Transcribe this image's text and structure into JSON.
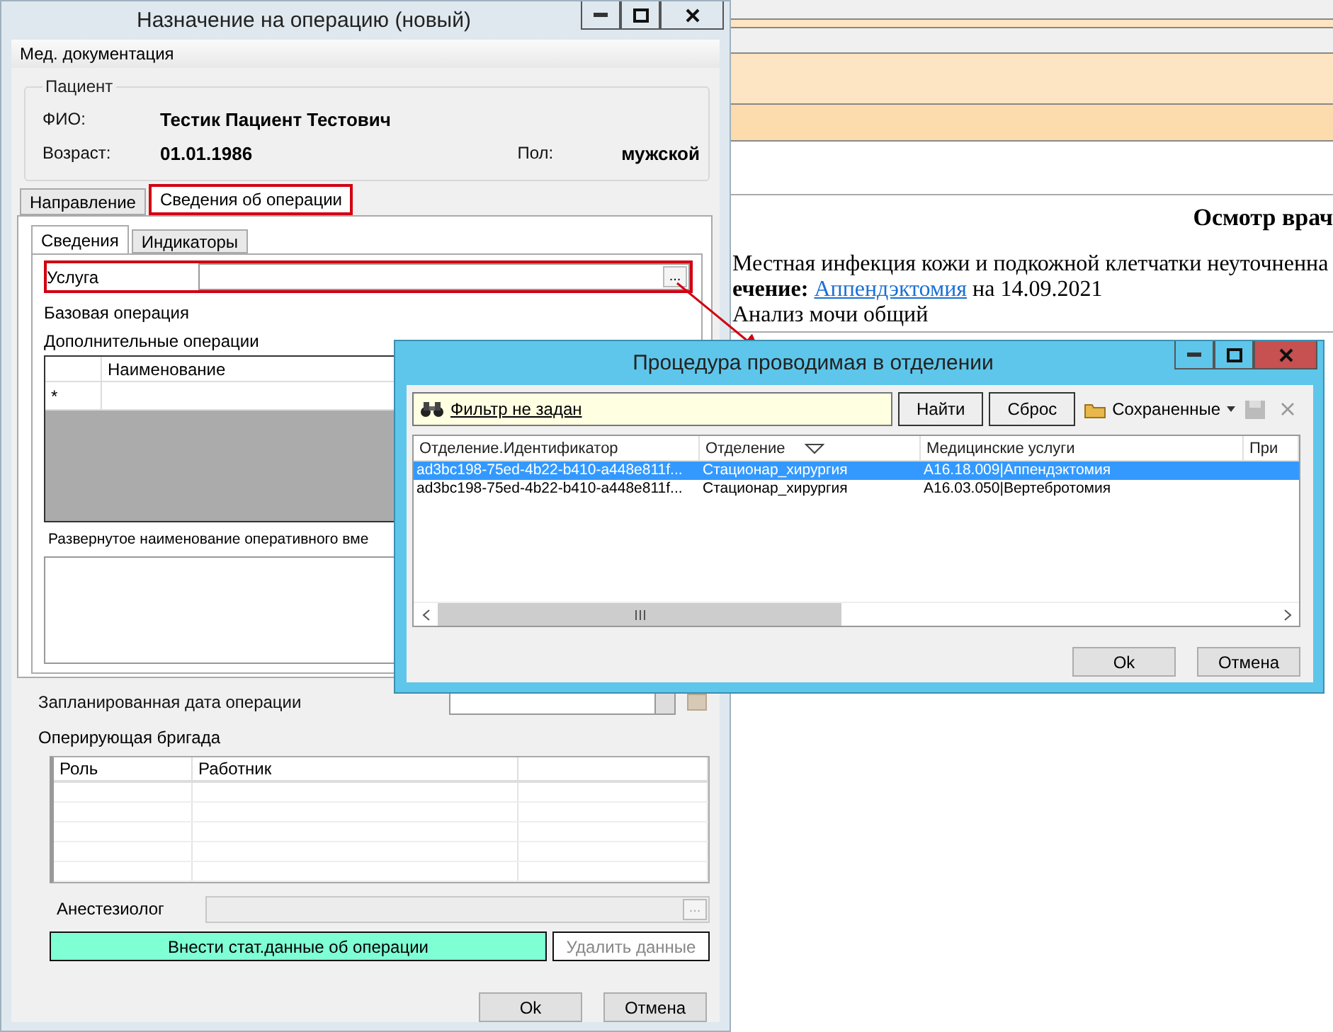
{
  "background_document": {
    "title": "Осмотр врач",
    "lines": [
      {
        "kind": "plain",
        "text": "Местная инфекция кожи и подкожной клетчатки неуточненна"
      },
      {
        "kind": "link",
        "label": "ечение:",
        "link": "Аппендэктомия",
        "text": "на 14.09.2021"
      },
      {
        "kind": "plain",
        "text": "Анализ мочи общий"
      }
    ]
  },
  "main_window": {
    "title": "Назначение на операцию (новый)",
    "menu": [
      "Мед. документация"
    ],
    "patient": {
      "group_title": "Пациент",
      "name_label": "ФИО:",
      "name": "Тестик Пациент Тестович",
      "age_label": "Возраст:",
      "age": "01.01.1986",
      "sex_label": "Пол:",
      "sex": "мужской"
    },
    "tabs": [
      {
        "label": "Направление",
        "selected": false,
        "highlighted": false
      },
      {
        "label": "Сведения об операции",
        "selected": true,
        "highlighted": true
      }
    ],
    "subtabs": [
      {
        "label": "Сведения",
        "selected": true
      },
      {
        "label": "Индикаторы",
        "selected": false
      }
    ],
    "service": {
      "label": "Услуга",
      "button": "...",
      "highlighted": true
    },
    "base_operation_label": "Базовая операция",
    "additional_operations": {
      "label": "Дополнительные операции",
      "columns": [
        "Наименование"
      ],
      "new_row_marker": "*"
    },
    "expanded_name_label": "Развернутое наименование оперативного вме",
    "planned_date_label": "Запланированная дата операции",
    "team": {
      "label": "Оперирующая бригада",
      "columns": [
        "Роль",
        "Работник"
      ]
    },
    "anesthesiologist": {
      "label": "Анестезиолог",
      "button": "...",
      "disabled": true
    },
    "actions": [
      {
        "label": "Внести стат.данные об операции",
        "disabled": false
      },
      {
        "label": "Удалить данные",
        "disabled": true
      }
    ],
    "buttons": [
      "Ok",
      "Отмена"
    ]
  },
  "dialog": {
    "title": "Процедура проводимая в отделении",
    "filter": "Фильтр не задан",
    "search_buttons": [
      "Найти",
      "Сброс"
    ],
    "saved": "Сохраненные",
    "columns": [
      {
        "label": "Отделение.Идентификатор",
        "sorted": false
      },
      {
        "label": "Отделение",
        "sorted": true
      },
      {
        "label": "Медицинские услуги",
        "sorted": false
      },
      {
        "label": "При",
        "sorted": false
      }
    ],
    "rows": [
      {
        "cells": [
          "ad3bc198-75ed-4b22-b410-a448e811f...",
          "Стационар_хирургия",
          "A16.18.009|Аппендэктомия"
        ],
        "selected": true
      },
      {
        "cells": [
          "ad3bc198-75ed-4b22-b410-a448e811f...",
          "Стационар_хирургия",
          "A16.03.050|Вертебротомия"
        ],
        "selected": false
      }
    ],
    "buttons": [
      "Ok",
      "Отмена"
    ]
  }
}
